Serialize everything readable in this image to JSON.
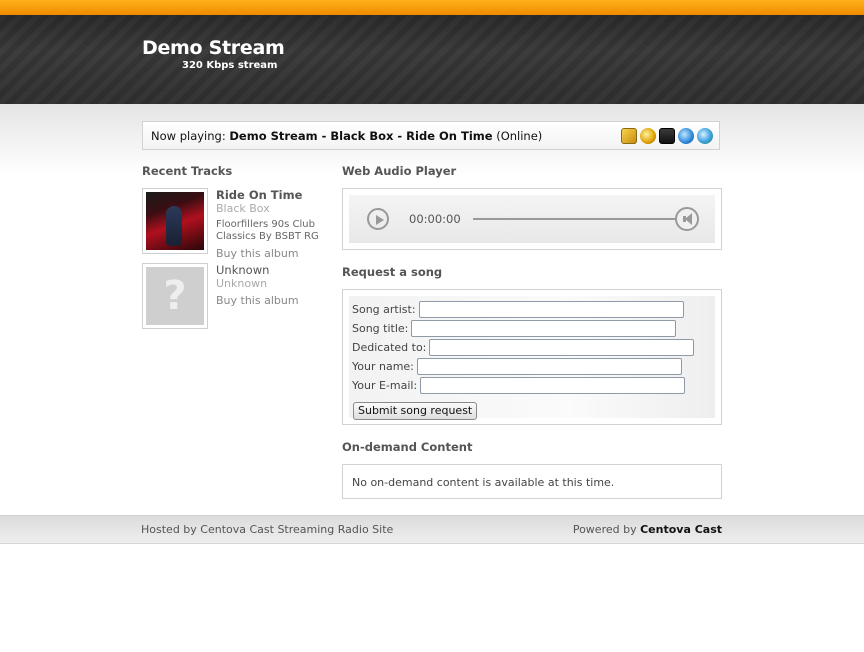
{
  "header": {
    "title": "Demo Stream",
    "subtitle": "320 Kbps stream"
  },
  "now_playing": {
    "label": "Now playing: ",
    "track": "Demo Stream - Black Box - Ride On Time",
    "status": " (Online)",
    "icons": [
      "winamp-icon",
      "windows-media-player-icon",
      "realplayer-icon",
      "quicktime-icon",
      "itunes-icon"
    ]
  },
  "recent_tracks": {
    "heading": "Recent Tracks",
    "items": [
      {
        "title": "Ride On Time",
        "artist": "Black Box",
        "album": "Floorfillers 90s Club Classics By BSBT RG",
        "buy": "Buy this album"
      },
      {
        "title": "Unknown",
        "artist": "Unknown",
        "placeholder": "?",
        "buy": "Buy this album"
      }
    ]
  },
  "player": {
    "heading": "Web Audio Player",
    "time": "00:00:00"
  },
  "request": {
    "heading": "Request a song",
    "fields": {
      "artist": "Song artist:",
      "title": "Song title:",
      "dedicated": "Dedicated to:",
      "name": "Your name:",
      "email": "Your E-mail:"
    },
    "submit": "Submit song request"
  },
  "ondemand": {
    "heading": "On-demand Content",
    "message": "No on-demand content is available at this time."
  },
  "footer": {
    "hosted": "Hosted by Centova Cast Streaming Radio Site",
    "powered_label": "Powered by ",
    "powered_brand": "Centova Cast"
  },
  "colors": {
    "accent": "#f5a00a",
    "header_bg": "#3a3a3a"
  }
}
